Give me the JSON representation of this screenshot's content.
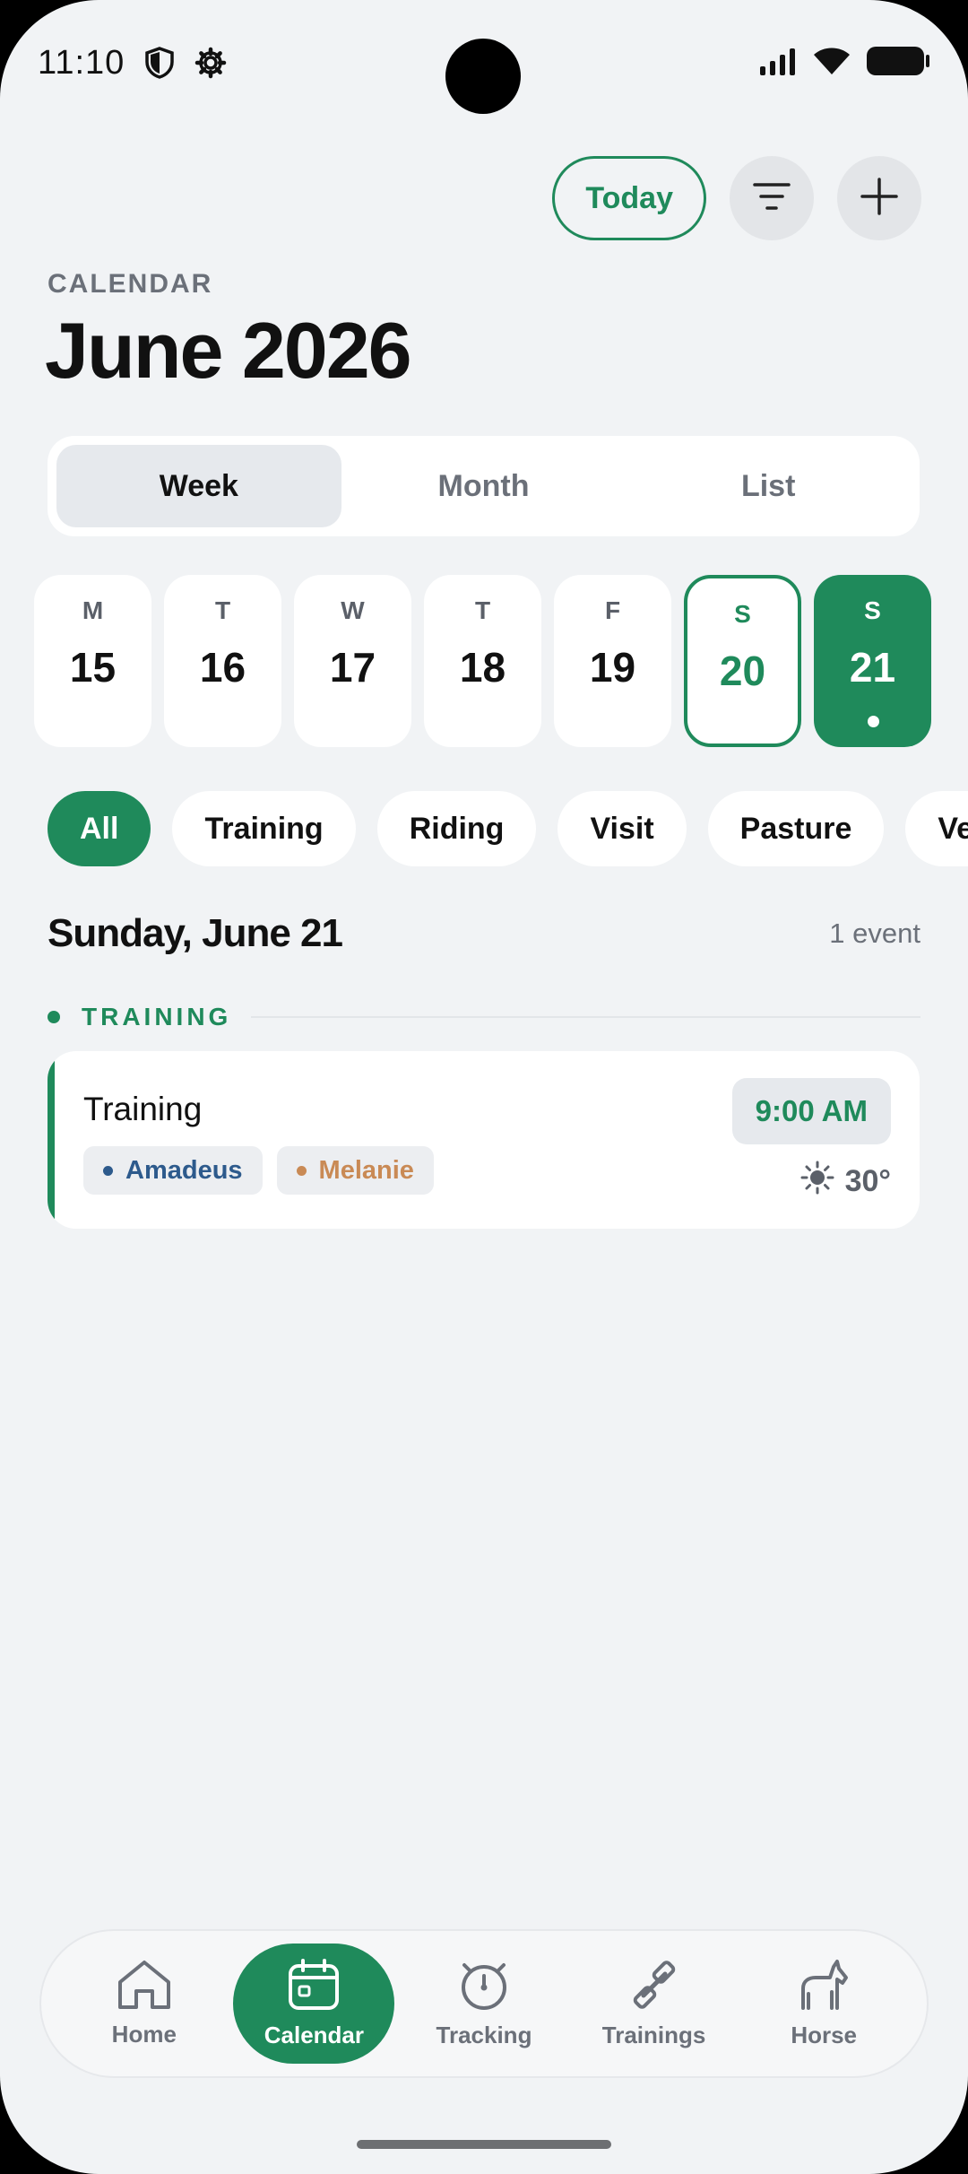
{
  "status_bar": {
    "time": "11:10"
  },
  "header": {
    "today_button": "Today",
    "eyebrow": "CALENDAR",
    "title": "June 2026"
  },
  "view_tabs": [
    {
      "label": "Week",
      "active": true
    },
    {
      "label": "Month",
      "active": false
    },
    {
      "label": "List",
      "active": false
    }
  ],
  "week_days": [
    {
      "letter": "M",
      "number": "15"
    },
    {
      "letter": "T",
      "number": "16"
    },
    {
      "letter": "W",
      "number": "17"
    },
    {
      "letter": "T",
      "number": "18"
    },
    {
      "letter": "F",
      "number": "19"
    },
    {
      "letter": "S",
      "number": "20",
      "state": "today"
    },
    {
      "letter": "S",
      "number": "21",
      "state": "selected",
      "has_event": true
    }
  ],
  "filters": [
    {
      "label": "All",
      "active": true
    },
    {
      "label": "Training"
    },
    {
      "label": "Riding"
    },
    {
      "label": "Visit"
    },
    {
      "label": "Pasture"
    },
    {
      "label": "Ve"
    }
  ],
  "day_section": {
    "heading": "Sunday, June 21",
    "count": "1 event",
    "group_label": "TRAINING"
  },
  "event": {
    "title": "Training",
    "time": "9:00 AM",
    "temperature": "30°",
    "tags": [
      {
        "label": "Amadeus",
        "color": "#2d5a8c"
      },
      {
        "label": "Melanie",
        "color": "#c98a55"
      }
    ]
  },
  "bottom_nav": [
    {
      "label": "Home",
      "icon": "home-icon"
    },
    {
      "label": "Calendar",
      "icon": "calendar-icon",
      "active": true
    },
    {
      "label": "Tracking",
      "icon": "stopwatch-icon"
    },
    {
      "label": "Trainings",
      "icon": "dumbbell-icon"
    },
    {
      "label": "Horse",
      "icon": "horse-icon"
    }
  ],
  "colors": {
    "accent": "#1f8a5b",
    "background": "#f1f3f5"
  }
}
